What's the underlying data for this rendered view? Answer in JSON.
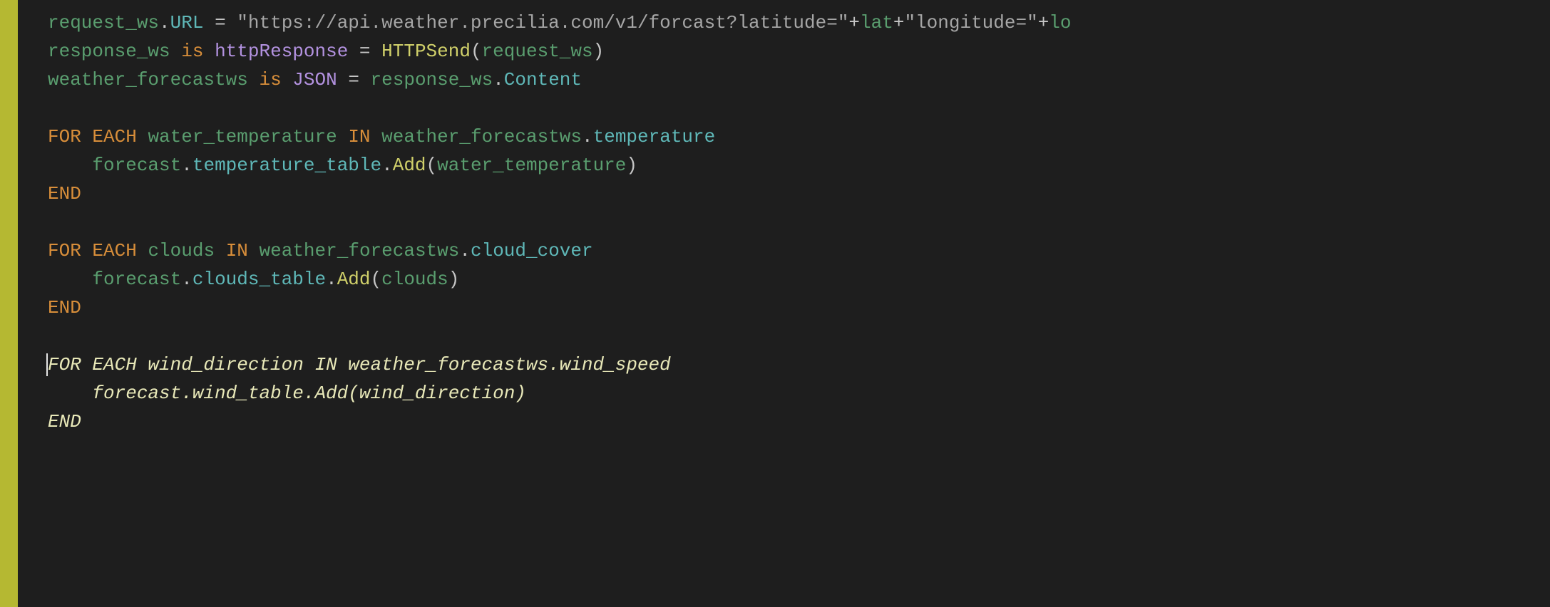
{
  "lines": [
    {
      "type": "code",
      "tokens": [
        {
          "cls": "t-var",
          "text": "request_ws"
        },
        {
          "cls": "t-dot",
          "text": "."
        },
        {
          "cls": "t-member",
          "text": "URL"
        },
        {
          "cls": "t-default",
          "text": " "
        },
        {
          "cls": "t-eq",
          "text": "="
        },
        {
          "cls": "t-default",
          "text": " "
        },
        {
          "cls": "t-string",
          "text": "\"https://api.weather.precilia.com/v1/forcast?latitude=\""
        },
        {
          "cls": "t-plus",
          "text": "+"
        },
        {
          "cls": "t-var",
          "text": "lat"
        },
        {
          "cls": "t-plus",
          "text": "+"
        },
        {
          "cls": "t-string",
          "text": "\"longitude=\""
        },
        {
          "cls": "t-plus",
          "text": "+"
        },
        {
          "cls": "t-var",
          "text": "lo"
        }
      ]
    },
    {
      "type": "code",
      "tokens": [
        {
          "cls": "t-var",
          "text": "response_ws"
        },
        {
          "cls": "t-default",
          "text": " "
        },
        {
          "cls": "t-keyword",
          "text": "is"
        },
        {
          "cls": "t-default",
          "text": " "
        },
        {
          "cls": "t-type",
          "text": "httpResponse"
        },
        {
          "cls": "t-default",
          "text": " "
        },
        {
          "cls": "t-eq",
          "text": "="
        },
        {
          "cls": "t-default",
          "text": " "
        },
        {
          "cls": "t-func",
          "text": "HTTPSend"
        },
        {
          "cls": "t-paren",
          "text": "("
        },
        {
          "cls": "t-var",
          "text": "request_ws"
        },
        {
          "cls": "t-paren",
          "text": ")"
        }
      ]
    },
    {
      "type": "code",
      "tokens": [
        {
          "cls": "t-var",
          "text": "weather_forecastws"
        },
        {
          "cls": "t-default",
          "text": " "
        },
        {
          "cls": "t-keyword",
          "text": "is"
        },
        {
          "cls": "t-default",
          "text": " "
        },
        {
          "cls": "t-type",
          "text": "JSON"
        },
        {
          "cls": "t-default",
          "text": " "
        },
        {
          "cls": "t-eq",
          "text": "="
        },
        {
          "cls": "t-default",
          "text": " "
        },
        {
          "cls": "t-var",
          "text": "response_ws"
        },
        {
          "cls": "t-dot",
          "text": "."
        },
        {
          "cls": "t-member",
          "text": "Content"
        }
      ]
    },
    {
      "type": "blank"
    },
    {
      "type": "code",
      "tokens": [
        {
          "cls": "t-keyword",
          "text": "FOR"
        },
        {
          "cls": "t-default",
          "text": " "
        },
        {
          "cls": "t-keyword",
          "text": "EACH"
        },
        {
          "cls": "t-default",
          "text": " "
        },
        {
          "cls": "t-var",
          "text": "water_temperature"
        },
        {
          "cls": "t-default",
          "text": " "
        },
        {
          "cls": "t-keyword",
          "text": "IN"
        },
        {
          "cls": "t-default",
          "text": " "
        },
        {
          "cls": "t-var",
          "text": "weather_forecastws"
        },
        {
          "cls": "t-dot",
          "text": "."
        },
        {
          "cls": "t-member",
          "text": "temperature"
        }
      ]
    },
    {
      "type": "code",
      "tokens": [
        {
          "cls": "t-default",
          "text": "    "
        },
        {
          "cls": "t-var",
          "text": "forecast"
        },
        {
          "cls": "t-dot",
          "text": "."
        },
        {
          "cls": "t-member",
          "text": "temperature_table"
        },
        {
          "cls": "t-dot",
          "text": "."
        },
        {
          "cls": "t-func",
          "text": "Add"
        },
        {
          "cls": "t-paren",
          "text": "("
        },
        {
          "cls": "t-var",
          "text": "water_temperature"
        },
        {
          "cls": "t-paren",
          "text": ")"
        }
      ]
    },
    {
      "type": "code",
      "tokens": [
        {
          "cls": "t-keyword",
          "text": "END"
        }
      ]
    },
    {
      "type": "blank"
    },
    {
      "type": "code",
      "tokens": [
        {
          "cls": "t-keyword",
          "text": "FOR"
        },
        {
          "cls": "t-default",
          "text": " "
        },
        {
          "cls": "t-keyword",
          "text": "EACH"
        },
        {
          "cls": "t-default",
          "text": " "
        },
        {
          "cls": "t-var",
          "text": "clouds"
        },
        {
          "cls": "t-default",
          "text": " "
        },
        {
          "cls": "t-keyword",
          "text": "IN"
        },
        {
          "cls": "t-default",
          "text": " "
        },
        {
          "cls": "t-var",
          "text": "weather_forecastws"
        },
        {
          "cls": "t-dot",
          "text": "."
        },
        {
          "cls": "t-member",
          "text": "cloud_cover"
        }
      ]
    },
    {
      "type": "code",
      "tokens": [
        {
          "cls": "t-default",
          "text": "    "
        },
        {
          "cls": "t-var",
          "text": "forecast"
        },
        {
          "cls": "t-dot",
          "text": "."
        },
        {
          "cls": "t-member",
          "text": "clouds_table"
        },
        {
          "cls": "t-dot",
          "text": "."
        },
        {
          "cls": "t-func",
          "text": "Add"
        },
        {
          "cls": "t-paren",
          "text": "("
        },
        {
          "cls": "t-var",
          "text": "clouds"
        },
        {
          "cls": "t-paren",
          "text": ")"
        }
      ]
    },
    {
      "type": "code",
      "tokens": [
        {
          "cls": "t-keyword",
          "text": "END"
        }
      ]
    },
    {
      "type": "blank"
    },
    {
      "type": "suggestion",
      "cursor": true,
      "tokens": [
        {
          "cls": "suggestion",
          "text": "FOR EACH wind_direction IN weather_forecastws.wind_speed"
        }
      ]
    },
    {
      "type": "suggestion",
      "tokens": [
        {
          "cls": "suggestion",
          "text": "    forecast.wind_table.Add(wind_direction)"
        }
      ]
    },
    {
      "type": "suggestion",
      "tokens": [
        {
          "cls": "suggestion",
          "text": "END"
        }
      ]
    }
  ]
}
